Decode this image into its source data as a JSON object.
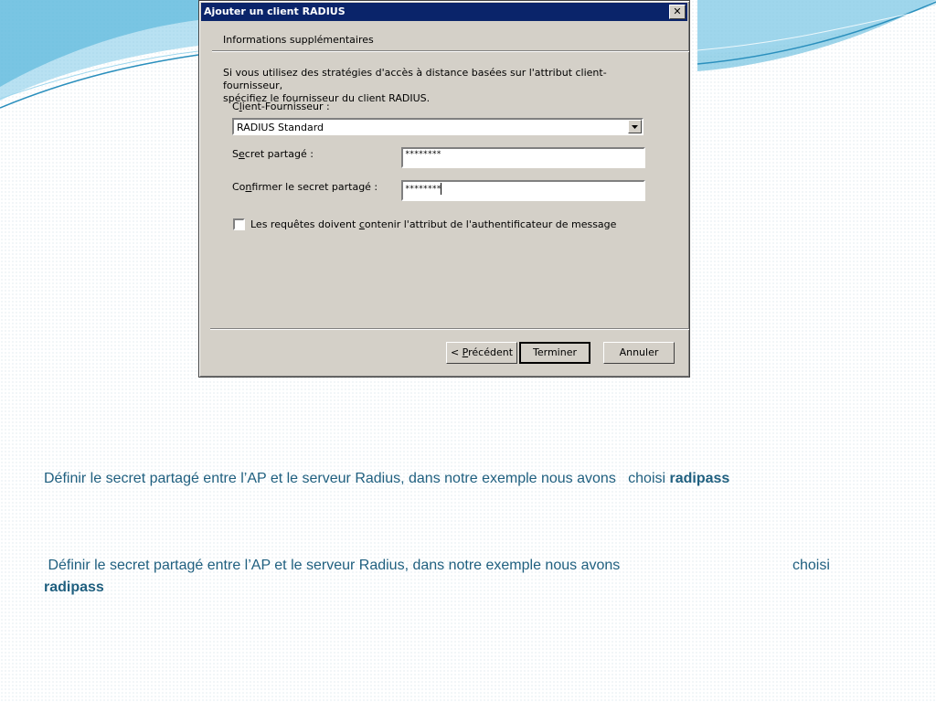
{
  "dialog": {
    "title": "Ajouter un client RADIUS",
    "close_glyph": "✕",
    "header_title": "Informations supplémentaires",
    "description_line1": "Si vous utilisez des stratégies d'accès à distance basées sur l'attribut client-fournisseur,",
    "description_line2": "spécifiez le fournisseur du client RADIUS.",
    "vendor_label_pre": "C",
    "vendor_label_u": "l",
    "vendor_label_post": "ient-Fournisseur :",
    "vendor_value": "RADIUS Standard",
    "secret_label_pre": "S",
    "secret_label_u": "e",
    "secret_label_post": "cret partagé :",
    "secret_value": "********",
    "confirm_label_pre": "Co",
    "confirm_label_u": "n",
    "confirm_label_post": "firmer le secret partagé :",
    "confirm_value": "********",
    "checkbox_label_pre": "Les requêtes doivent ",
    "checkbox_label_u": "c",
    "checkbox_label_post": "ontenir l'attribut de l'authentificateur de message",
    "checkbox_checked": false,
    "buttons": {
      "back_pre": "< ",
      "back_u": "P",
      "back_post": "récédent",
      "finish": "Terminer",
      "cancel": "Annuler"
    }
  },
  "slide": {
    "text1_main": "Définir le secret partagé entre l’AP et le serveur Radius, dans notre exemple nous avons   choisi ",
    "text1_bold": "radipass",
    "text2_main": " Définir le secret partagé entre l’AP et le serveur Radius, dans notre exemple nous avons",
    "text2_choisi": "choisi",
    "text2_bold": "radipass"
  },
  "colors": {
    "accent_text": "#1f5f7f",
    "title_bar": "#0a246a",
    "swoosh": "#4fb3d9"
  }
}
